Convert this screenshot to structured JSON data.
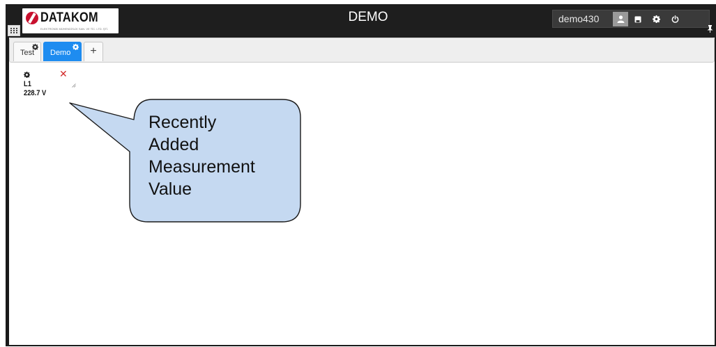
{
  "header": {
    "logo_text": "DATAKOM",
    "logo_subtitle": "ELEKTRONİK MÜHENDİSLİK SAN. VE TİC. LTD. ŞTİ.",
    "title": "DEMO",
    "username": "demo430"
  },
  "tabs": [
    {
      "label": "Test",
      "active": false
    },
    {
      "label": "Demo",
      "active": true
    }
  ],
  "add_tab_label": "+",
  "widget": {
    "label": "L1",
    "value": "228.7 V",
    "close_glyph": "✕"
  },
  "callout": {
    "lines": [
      "Recently",
      "Added",
      "Measurement",
      "Value"
    ]
  },
  "colors": {
    "accent": "#1e8cf0",
    "brand": "#c8102e",
    "callout_fill": "#c5d9f1"
  },
  "icons": [
    "grid-icon",
    "user-icon",
    "save-icon",
    "gear-icon",
    "power-icon",
    "pin-icon",
    "close-icon",
    "resize-handle-icon"
  ]
}
